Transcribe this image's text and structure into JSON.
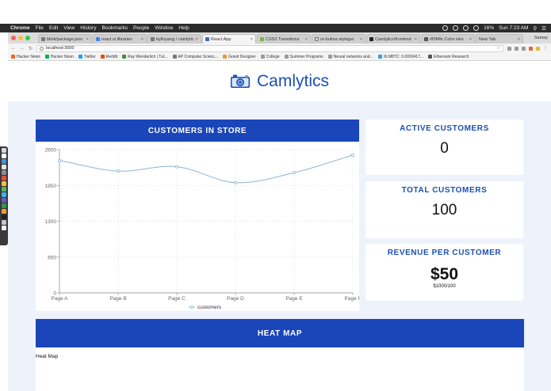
{
  "menubar": {
    "app": "Chrome",
    "items": [
      "File",
      "Edit",
      "View",
      "History",
      "Bookmarks",
      "People",
      "Window",
      "Help"
    ],
    "battery": "16%",
    "clock": "Sun 7:23 AM"
  },
  "tabs": [
    {
      "label": "blink/package.json"
    },
    {
      "label": "react ui libraries"
    },
    {
      "label": "bylluyang / camlytic"
    },
    {
      "label": "React App",
      "active": true
    },
    {
      "label": "CSS3 Transitions"
    },
    {
      "label": "re-bulma stylegui"
    },
    {
      "label": "Camlytics/frontend"
    },
    {
      "label": "#f0f4fe Color Hex"
    },
    {
      "label": "New Tab"
    }
  ],
  "profile": "Samay",
  "address": {
    "url": "localhost:3000"
  },
  "bookmarks": [
    {
      "label": "Hacker News",
      "color": "#f26522"
    },
    {
      "label": "Hacker Noon",
      "color": "#00b140"
    },
    {
      "label": "Twitter",
      "color": "#1da1f2"
    },
    {
      "label": "Reddit",
      "color": "#ff4500"
    },
    {
      "label": "Ray Wenderlich | Tut...",
      "color": "#3c8f3c"
    },
    {
      "label": "AP Computer Scienc...",
      "color": "#777777"
    },
    {
      "label": "Gravit Designer",
      "color": "#e89b2a"
    },
    {
      "label": "College",
      "color": "#9a9a9a"
    },
    {
      "label": "Summer Programs",
      "color": "#9a9a9a"
    },
    {
      "label": "Neural networks and...",
      "color": "#9a9a9a"
    },
    {
      "label": "XLM8TC: 0.0000417...",
      "color": "#3aa0d8"
    },
    {
      "label": "Ethereum Research",
      "color": "#555555"
    }
  ],
  "app": {
    "brand": "Camlytics",
    "accent": "#1a46b9",
    "customers_panel_title": "CUSTOMERS IN STORE",
    "heatmap_panel_title": "HEAT MAP",
    "heatmap_label": "Heat Map",
    "stats": {
      "active_label": "ACTIVE CUSTOMERS",
      "active_value": "0",
      "total_label": "TOTAL CUSTOMERS",
      "total_value": "100",
      "revenue_label": "REVENUE PER CUSTOMER",
      "revenue_value": "$50",
      "revenue_sub": "$1000/100"
    }
  },
  "chart_data": {
    "type": "line",
    "title": "",
    "categories": [
      "Page A",
      "Page B",
      "Page C",
      "Page D",
      "Page E",
      "Page F"
    ],
    "series": [
      {
        "name": "customers",
        "color": "#8bb6d6",
        "values": [
          2400,
          2210,
          2290,
          2000,
          2181,
          2500
        ]
      }
    ],
    "ylim": [
      0,
      2600
    ],
    "yticks": [
      0,
      650,
      1300,
      1950,
      2600
    ],
    "xlabel": "",
    "ylabel": "",
    "grid": true,
    "legend": "bottom"
  }
}
